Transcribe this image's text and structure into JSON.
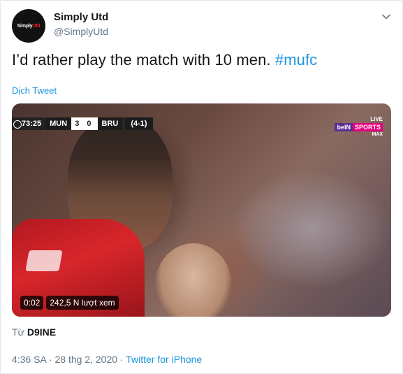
{
  "author": {
    "display_name": "Simply Utd",
    "handle": "@SimplyUtd",
    "avatar_text_a": "Simply",
    "avatar_text_b": "Utd"
  },
  "tweet": {
    "text": "I’d rather play the match with 10 men. ",
    "hashtag": "#mufc",
    "translate_label": "Dịch Tweet"
  },
  "video": {
    "scorebar": {
      "time": "73:25",
      "home": "MUN",
      "score": "3 0",
      "away": "BRU",
      "aggregate": "(4-1)"
    },
    "broadcaster": {
      "live": "LIVE",
      "bein": "beIN",
      "sports": "SPORTS",
      "max": "MAX"
    },
    "elapsed": "0:02",
    "views": "242,5 N lượt xem"
  },
  "source": {
    "prefix": "Từ ",
    "name": "D9INE"
  },
  "meta": {
    "time": "4:36 SA",
    "sep1": " · ",
    "date": "28 thg 2, 2020",
    "sep2": " · ",
    "client": "Twitter for iPhone"
  },
  "colors": {
    "link": "#1b95e0",
    "muted": "#657786",
    "text": "#14171a"
  },
  "icons": {
    "menu": "chevron-down-icon"
  }
}
